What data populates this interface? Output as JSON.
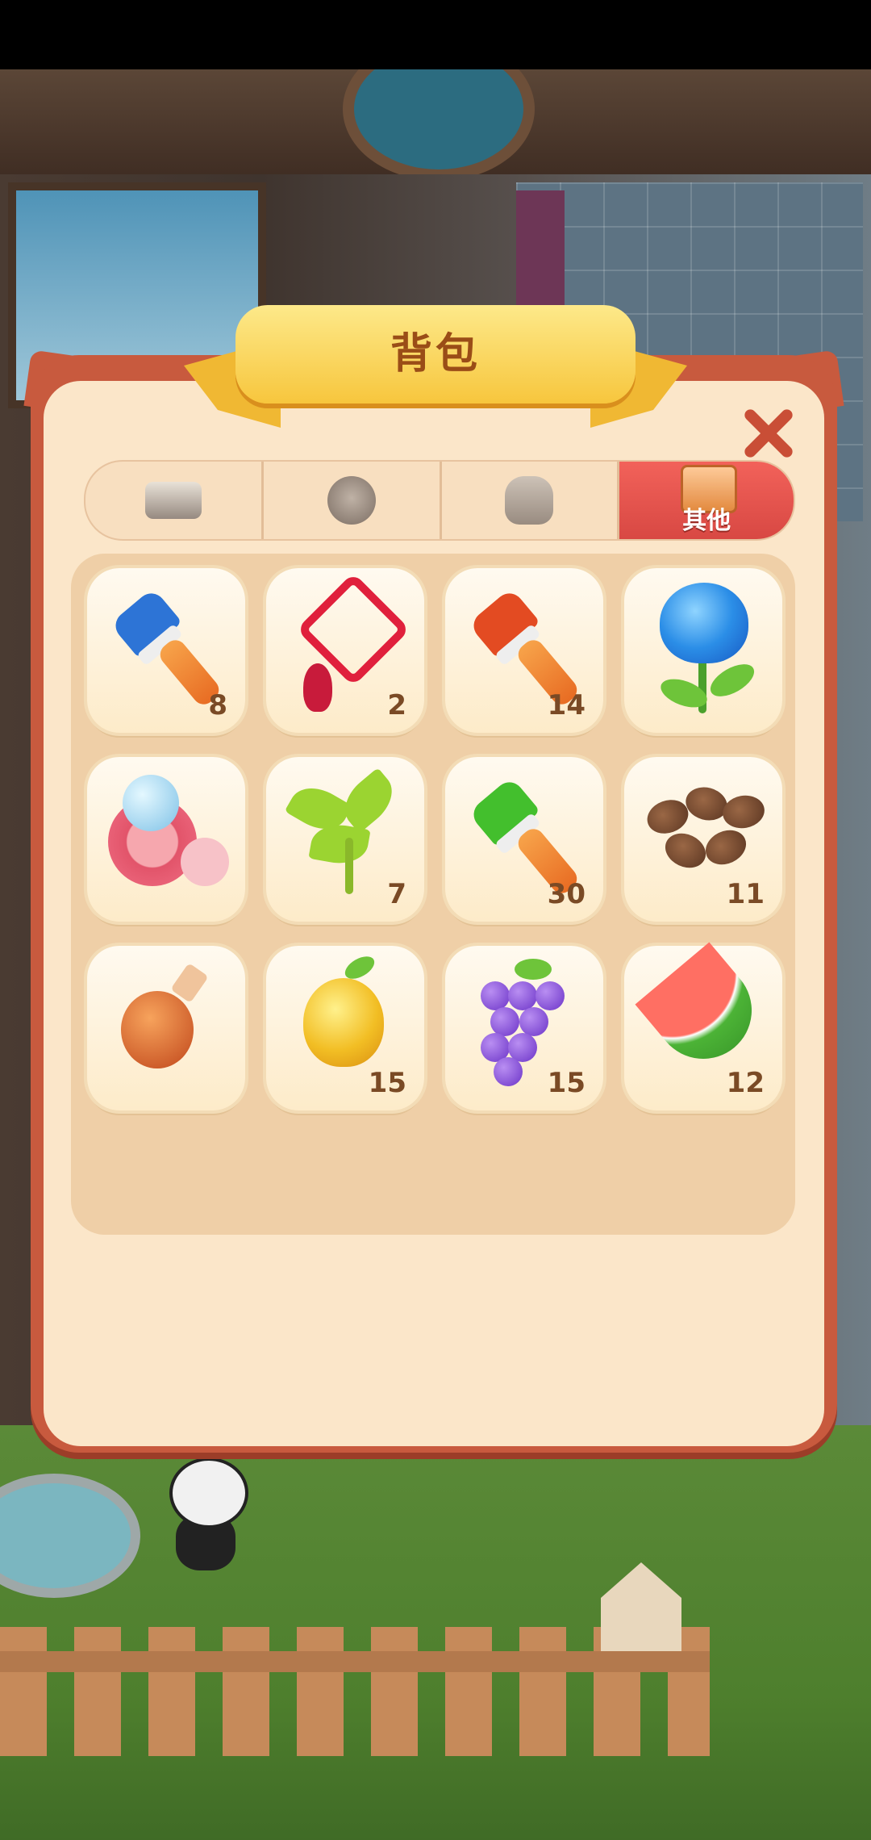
{
  "dialog": {
    "title": "背包",
    "close_icon": "close-icon"
  },
  "tabs": [
    {
      "icon": "cake-icon",
      "label": "",
      "active": false
    },
    {
      "icon": "bear-icon",
      "label": "",
      "active": false
    },
    {
      "icon": "bag-icon",
      "label": "",
      "active": false
    },
    {
      "icon": "chest-icon",
      "label": "其他",
      "active": true
    }
  ],
  "items": [
    {
      "name": "blue-paint-brush",
      "count": "8"
    },
    {
      "name": "chinese-knot",
      "count": "2"
    },
    {
      "name": "red-paint-brush",
      "count": "14"
    },
    {
      "name": "blue-rose",
      "count": ""
    },
    {
      "name": "blush-compact",
      "count": ""
    },
    {
      "name": "tea-leaves",
      "count": "7"
    },
    {
      "name": "green-paint-brush",
      "count": "30"
    },
    {
      "name": "coffee-beans",
      "count": "11"
    },
    {
      "name": "potion-bottle",
      "count": ""
    },
    {
      "name": "pear",
      "count": "15"
    },
    {
      "name": "grapes",
      "count": "15"
    },
    {
      "name": "watermelon-slice",
      "count": "12"
    }
  ],
  "colors": {
    "accent_red": "#d84843",
    "ribbon_yellow": "#f7c63d",
    "panel_cream": "#fbe6c9",
    "count_brown": "#7a4a25"
  }
}
